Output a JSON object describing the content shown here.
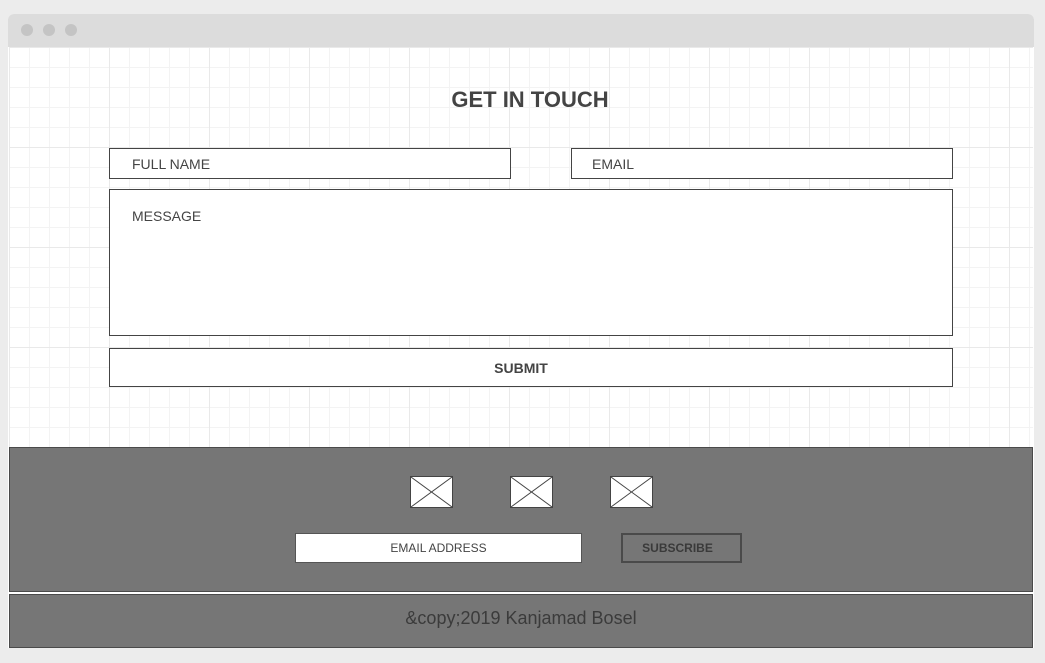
{
  "window": {
    "controls": [
      "close",
      "minimize",
      "maximize"
    ]
  },
  "contact": {
    "heading": "GET IN TOUCH",
    "full_name_placeholder": "FULL NAME",
    "email_placeholder": "EMAIL",
    "message_placeholder": "MESSAGE",
    "submit_label": "SUBMIT"
  },
  "footer": {
    "social_icons": [
      "image-placeholder-icon",
      "image-placeholder-icon",
      "image-placeholder-icon"
    ],
    "newsletter_placeholder": "EMAIL ADDRESS",
    "subscribe_label": "SUBSCRIBE",
    "copyright": "&copy;2019 Kanjamad Bosel"
  },
  "colors": {
    "footer_bg": "#767676",
    "titlebar_bg": "#dcdcdc",
    "text": "#444444"
  }
}
